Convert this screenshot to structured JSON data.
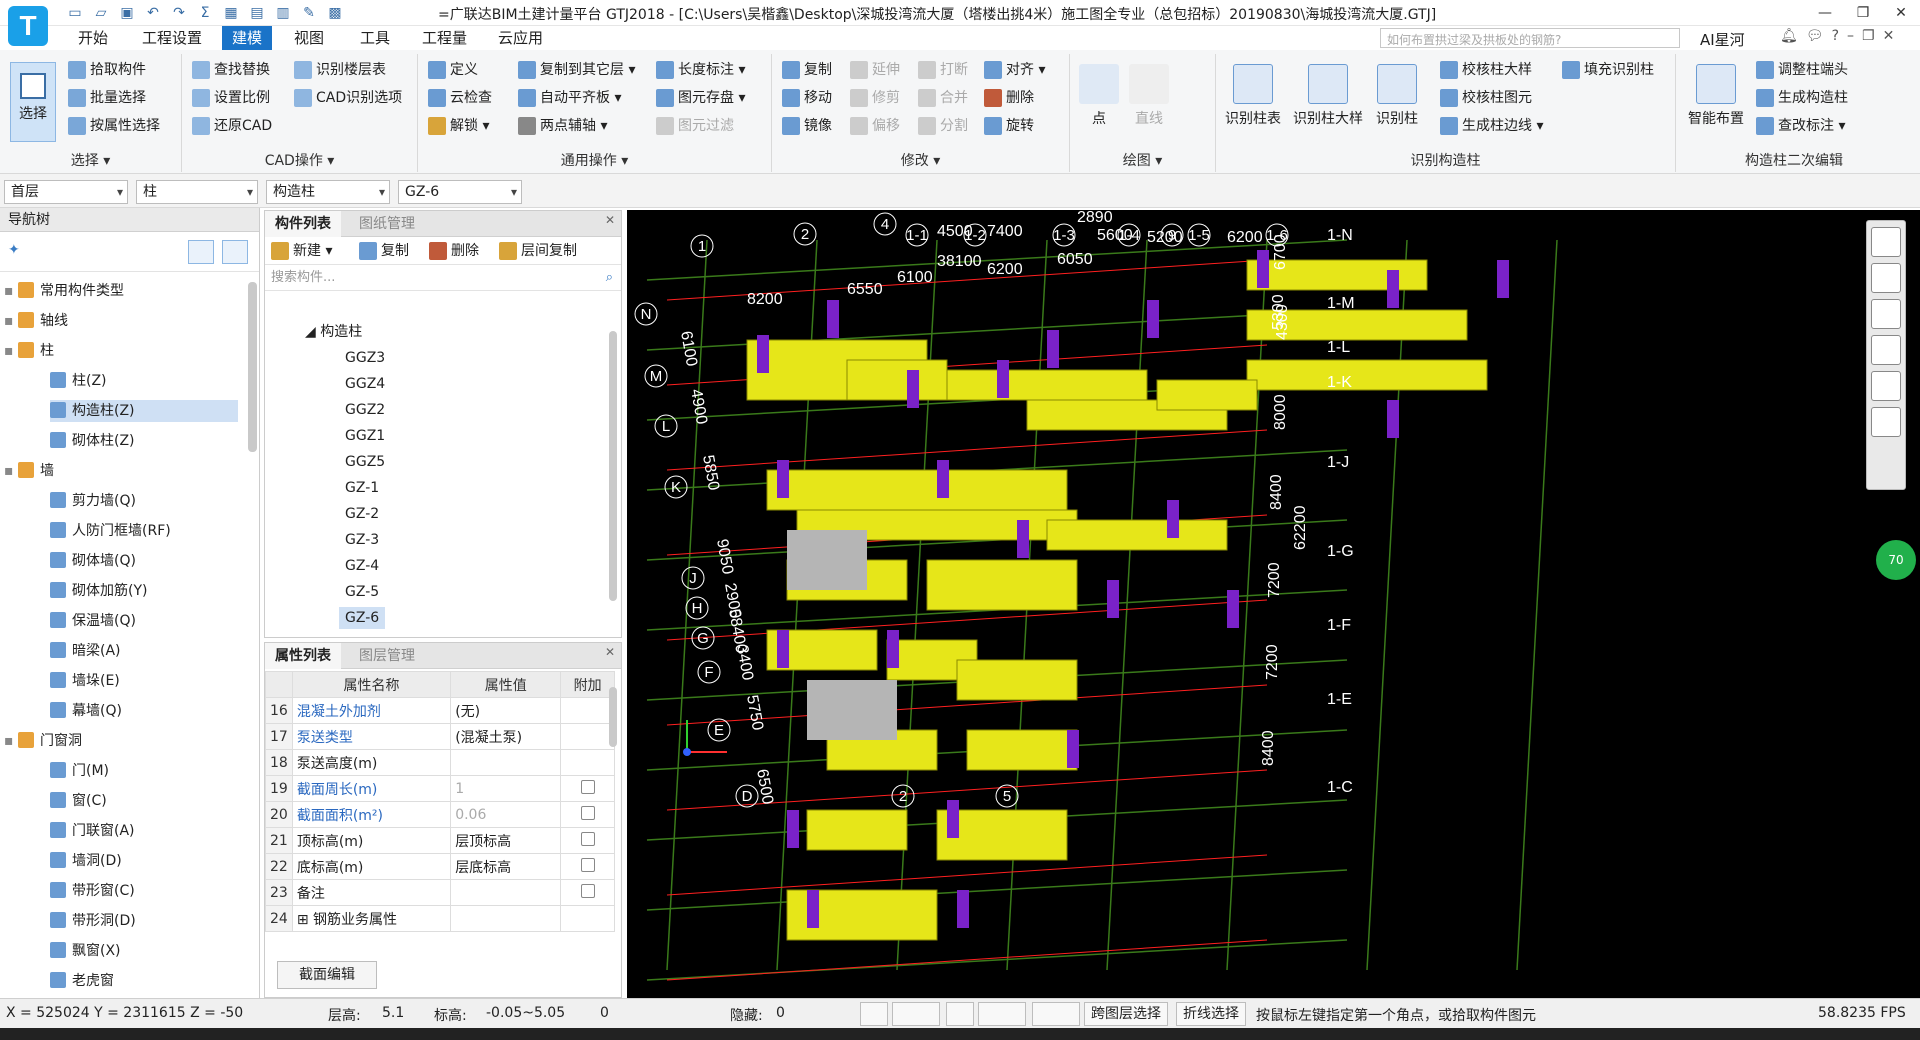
{
  "title": {
    "app_logo": "T",
    "text": "=广联达BIM土建计量平台 GTJ2018 - [C:\\Users\\吴楷鑫\\Desktop\\深城投湾流大厦（塔楼出挑4米）施工图全专业（总包招标）20190830\\海城投湾流大厦.GTJ]"
  },
  "menu": {
    "tabs": [
      "开始",
      "工程设置",
      "建模",
      "视图",
      "工具",
      "工程量",
      "云应用"
    ],
    "active": "建模",
    "search_placeholder": "如何布置拱过梁及拱板处的钢筋?",
    "ai_label": "AI星河"
  },
  "ribbon": {
    "select_label": "选择",
    "groups": {
      "select": "选择 ▾",
      "cad": "CAD操作 ▾",
      "common": "通用操作 ▾",
      "modify": "修改 ▾",
      "draw": "绘图 ▾",
      "identify": "识别构造柱",
      "secondary": "构造柱二次编辑"
    },
    "select_btns": [
      "拾取构件",
      "批量选择",
      "按属性选择"
    ],
    "cad_btns": [
      "查找替换",
      "设置比例",
      "还原CAD",
      "识别楼层表",
      "CAD识别选项"
    ],
    "common_btns": [
      "定义",
      "云检查",
      "解锁 ▾",
      "复制到其它层 ▾",
      "自动平齐板 ▾",
      "两点辅轴 ▾",
      "长度标注 ▾",
      "图元存盘 ▾",
      "图元过滤"
    ],
    "modify_btns": [
      "复制",
      "移动",
      "镜像",
      "延伸",
      "修剪",
      "偏移",
      "打断",
      "合并",
      "分割",
      "对齐 ▾",
      "删除",
      "旋转"
    ],
    "draw_btns": [
      "点",
      "直线"
    ],
    "identify_big": [
      "识别柱表",
      "识别柱大样",
      "识别柱"
    ],
    "identify_btns": [
      "校核柱大样",
      "校核柱图元",
      "生成柱边线 ▾",
      "填充识别柱"
    ],
    "secondary_big": "智能布置",
    "secondary_btns": [
      "调整柱端头",
      "生成构造柱",
      "查改标注 ▾"
    ]
  },
  "propbar": {
    "floor": "首层",
    "category": "柱",
    "type": "构造柱",
    "item": "GZ-6"
  },
  "nav": {
    "title": "导航树",
    "items": [
      {
        "label": "常用构件类型",
        "level": 0,
        "group": true
      },
      {
        "label": "轴线",
        "level": 0,
        "group": true
      },
      {
        "label": "柱",
        "level": 0,
        "group": true
      },
      {
        "label": "柱(Z)",
        "level": 1
      },
      {
        "label": "构造柱(Z)",
        "level": 1,
        "selected": true
      },
      {
        "label": "砌体柱(Z)",
        "level": 1
      },
      {
        "label": "墙",
        "level": 0,
        "group": true
      },
      {
        "label": "剪力墙(Q)",
        "level": 1
      },
      {
        "label": "人防门框墙(RF)",
        "level": 1
      },
      {
        "label": "砌体墙(Q)",
        "level": 1
      },
      {
        "label": "砌体加筋(Y)",
        "level": 1
      },
      {
        "label": "保温墙(Q)",
        "level": 1
      },
      {
        "label": "暗梁(A)",
        "level": 1
      },
      {
        "label": "墙垛(E)",
        "level": 1
      },
      {
        "label": "幕墙(Q)",
        "level": 1
      },
      {
        "label": "门窗洞",
        "level": 0,
        "group": true
      },
      {
        "label": "门(M)",
        "level": 1
      },
      {
        "label": "窗(C)",
        "level": 1
      },
      {
        "label": "门联窗(A)",
        "level": 1
      },
      {
        "label": "墙洞(D)",
        "level": 1
      },
      {
        "label": "带形窗(C)",
        "level": 1
      },
      {
        "label": "带形洞(D)",
        "level": 1
      },
      {
        "label": "飘窗(X)",
        "level": 1
      },
      {
        "label": "老虎窗",
        "level": 1
      }
    ]
  },
  "components": {
    "tabs": [
      "构件列表",
      "图纸管理"
    ],
    "tools": [
      "新建 ▾",
      "复制",
      "删除",
      "层间复制"
    ],
    "search_placeholder": "搜索构件...",
    "group": "构造柱",
    "items": [
      "GGZ3",
      "GGZ4",
      "GGZ2",
      "GGZ1",
      "GGZ5",
      "GZ-1",
      "GZ-2",
      "GZ-3",
      "GZ-4",
      "GZ-5",
      "GZ-6"
    ],
    "selected": "GZ-6"
  },
  "properties": {
    "tabs": [
      "属性列表",
      "图层管理"
    ],
    "headers": [
      "属性名称",
      "属性值",
      "附加"
    ],
    "rows": [
      {
        "n": "16",
        "name": "混凝土外加剂",
        "value": "(无)",
        "blue": true,
        "chk": false
      },
      {
        "n": "17",
        "name": "泵送类型",
        "value": "(混凝土泵)",
        "blue": true,
        "chk": false
      },
      {
        "n": "18",
        "name": "泵送高度(m)",
        "value": "",
        "blue": false,
        "chk": false
      },
      {
        "n": "19",
        "name": "截面周长(m)",
        "value": "1",
        "blue": true,
        "gray": true,
        "chk": true
      },
      {
        "n": "20",
        "name": "截面面积(m²)",
        "value": "0.06",
        "blue": true,
        "gray": true,
        "chk": true
      },
      {
        "n": "21",
        "name": "顶标高(m)",
        "value": "层顶标高",
        "blue": false,
        "chk": true
      },
      {
        "n": "22",
        "name": "底标高(m)",
        "value": "层底标高",
        "blue": false,
        "chk": true
      },
      {
        "n": "23",
        "name": "备注",
        "value": "",
        "blue": false,
        "chk": true
      },
      {
        "n": "24",
        "name": "⊞ 钢筋业务属性",
        "value": "",
        "blue": false,
        "chk": false
      }
    ],
    "edit_button": "截面编辑"
  },
  "viewport": {
    "axes_top": [
      "1-1",
      "1-2",
      "1-3",
      "1-4",
      "9",
      "1-5",
      "1-6"
    ],
    "axes_top_num": [
      "1",
      "2",
      "4"
    ],
    "axes_left": [
      "N",
      "M",
      "L",
      "K",
      "J",
      "H",
      "G",
      "F",
      "E",
      "D"
    ],
    "axes_right": [
      "1-N",
      "1-M",
      "1-L",
      "1-K",
      "1-J",
      "1-G",
      "1-F",
      "1-E",
      "1-C"
    ],
    "axes_bottom": [
      "2",
      "5"
    ],
    "dims_top": [
      "4500",
      "7400",
      "2890",
      "5600",
      "5200",
      "6200",
      "8200",
      "6550",
      "6100",
      "38100",
      "6200",
      "6050"
    ],
    "dims_left": [
      "6100",
      "4900",
      "5850",
      "9050",
      "2900",
      "58400",
      "3400",
      "5750",
      "6500"
    ],
    "dims_right": [
      "6700",
      "5300",
      "4300",
      "8000",
      "8400",
      "62200",
      "7200",
      "7200",
      "8400"
    ],
    "fps_badge": "70",
    "colors": {
      "wall": "#e6e619",
      "column": "#7a22c8",
      "concrete": "#b5b5b5",
      "grid": "#3a7a1a",
      "axis": "#ff2020"
    }
  },
  "status": {
    "coords": "X = 525024 Y = 2311615 Z = -50",
    "floor_height": "层高:",
    "floor_height_val": "5.1",
    "elevation": "标高:",
    "elevation_val": "-0.05~5.05",
    "zero": "0",
    "hidden": "隐藏:",
    "hidden_val": "0",
    "btn_cross": "跨图层选择",
    "btn_poly": "折线选择",
    "hint": "按鼠标左键指定第一个角点，或拾取构件图元",
    "fps": "58.8235 FPS"
  }
}
